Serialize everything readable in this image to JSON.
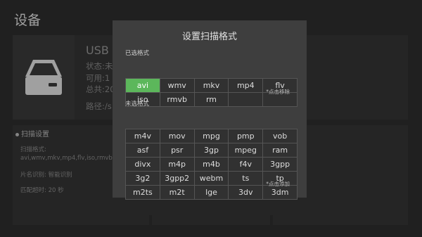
{
  "page": {
    "title": "设备"
  },
  "device": {
    "name": "USB",
    "status": "状态:未",
    "available": "可用:1",
    "total": "总共:20",
    "path": "路径:/s"
  },
  "settings": {
    "header": "扫描设置",
    "formats_label": "扫描格式:",
    "formats_value": "avi,wmv,mkv,mp4,flv,iso,rmvb,rm",
    "title_recognition": "片名识别: 智能识别",
    "match_timeout": "匹配超时: 20 秒"
  },
  "dialog": {
    "title": "设置扫描格式",
    "selected_label": "已选格式",
    "selected_hint": "*点击移除",
    "selected": [
      "avi",
      "wmv",
      "mkv",
      "mp4",
      "flv",
      "iso",
      "rmvb",
      "rm",
      "",
      ""
    ],
    "active_format": "avi",
    "unselected_label": "未选格式",
    "unselected_hint": "*点击添加",
    "unselected": [
      "m4v",
      "mov",
      "mpg",
      "pmp",
      "vob",
      "asf",
      "psr",
      "3gp",
      "mpeg",
      "ram",
      "divx",
      "m4p",
      "m4b",
      "f4v",
      "3gpp",
      "3g2",
      "3gpp2",
      "webm",
      "ts",
      "tp",
      "m2ts",
      "m2t",
      "lge",
      "3dv",
      "3dm"
    ]
  },
  "colors": {
    "background": "#2f2f2f",
    "panel": "#363636",
    "dialog": "#3e3e3e",
    "active": "#5cb75b"
  }
}
